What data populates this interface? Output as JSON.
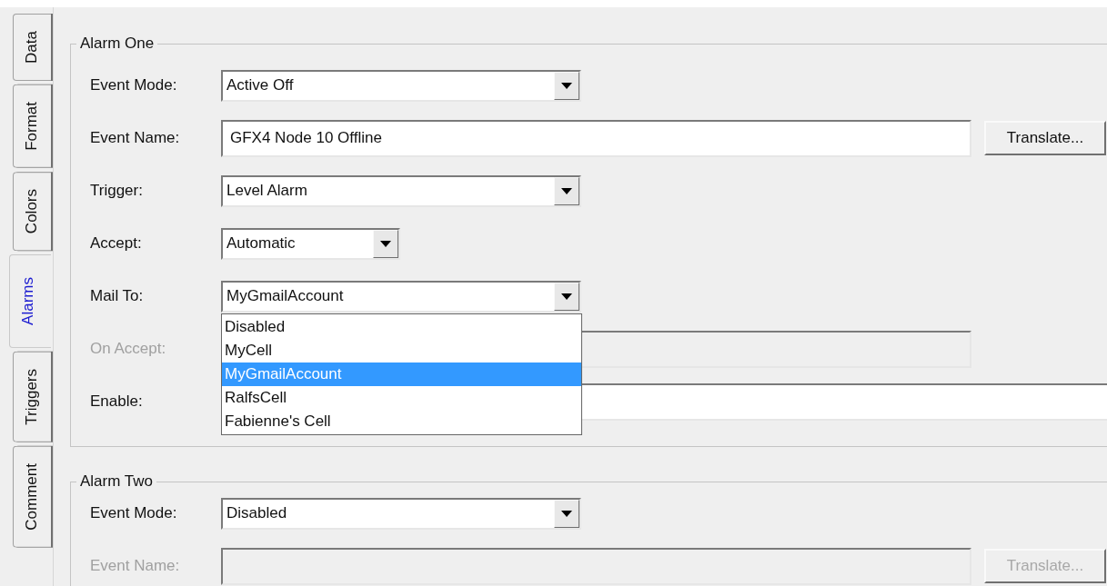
{
  "tabs": [
    {
      "label": "Data",
      "selected": false
    },
    {
      "label": "Format",
      "selected": false
    },
    {
      "label": "Colors",
      "selected": false
    },
    {
      "label": "Alarms",
      "selected": true
    },
    {
      "label": "Triggers",
      "selected": false
    },
    {
      "label": "Comment",
      "selected": false
    }
  ],
  "groups": [
    {
      "title": "Alarm One",
      "fields": [
        {
          "kind": "combo",
          "label": "Event Mode:",
          "value": "Active Off",
          "disabled": false
        },
        {
          "kind": "text",
          "label": "Event Name:",
          "value": "GFX4 Node 10 Offline",
          "button": "Translate...",
          "disabled": false
        },
        {
          "kind": "combo",
          "label": "Trigger:",
          "value": "Level Alarm",
          "disabled": false
        },
        {
          "kind": "short-combo",
          "label": "Accept:",
          "value": "Automatic",
          "disabled": false
        },
        {
          "kind": "combo",
          "label": "Mail To:",
          "value": "MyGmailAccount",
          "disabled": false,
          "expanded": true,
          "options": [
            {
              "label": "Disabled",
              "selected": false
            },
            {
              "label": "MyCell",
              "selected": false
            },
            {
              "label": "MyGmailAccount",
              "selected": true
            },
            {
              "label": "RalfsCell",
              "selected": false
            },
            {
              "label": "Fabienne's Cell",
              "selected": false
            }
          ]
        },
        {
          "kind": "text",
          "label": "On Accept:",
          "disabled": true
        },
        {
          "kind": "wide-text",
          "label": "Enable:",
          "disabled": false
        }
      ]
    },
    {
      "title": "Alarm Two",
      "fields": [
        {
          "kind": "combo",
          "label": "Event Mode:",
          "value": "Disabled",
          "disabled": false
        },
        {
          "kind": "text",
          "label": "Event Name:",
          "button": "Translate...",
          "disabled": true
        }
      ]
    }
  ]
}
